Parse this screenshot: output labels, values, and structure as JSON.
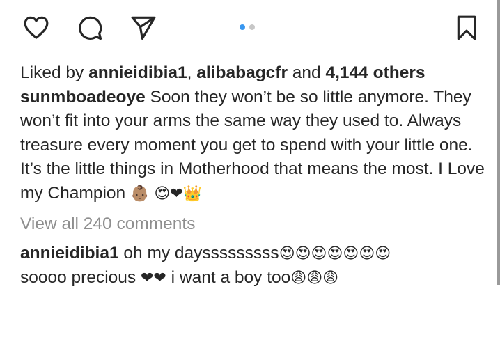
{
  "actions": {
    "like_icon": "heart-outline-icon",
    "comment_icon": "comment-bubble-icon",
    "share_icon": "paper-plane-icon",
    "save_icon": "bookmark-icon"
  },
  "carousel": {
    "active_color": "#3897f0",
    "inactive_color": "#c7c7c7",
    "count": 2,
    "active_index": 0
  },
  "likes": {
    "prefix": "Liked by ",
    "user1": "annieidibia1",
    "separator": ", ",
    "user2": "alibabagcfr",
    "and": " and ",
    "others": "4,144 others"
  },
  "caption": {
    "username": "sunmboadeoye",
    "text1": " Soon they won’t be so little anymore. They won’t fit into your arms the same way they used to. Always treasure every moment you get to spend with your little one.",
    "text2": "It’s the little things in Motherhood that means the most. I Love my Champion ",
    "emoji": "👶🏽 😍❤👑"
  },
  "view_all_comments": "View all 240 comments",
  "comment": {
    "username": "annieidibia1",
    "text1": " oh my daysssssssss",
    "emoji1": "😍😍😍😍😍😍😍",
    "text2": "soooo precious ",
    "emoji2": "❤❤",
    "text3": " i want a boy too",
    "emoji3": "😩😩😩"
  }
}
